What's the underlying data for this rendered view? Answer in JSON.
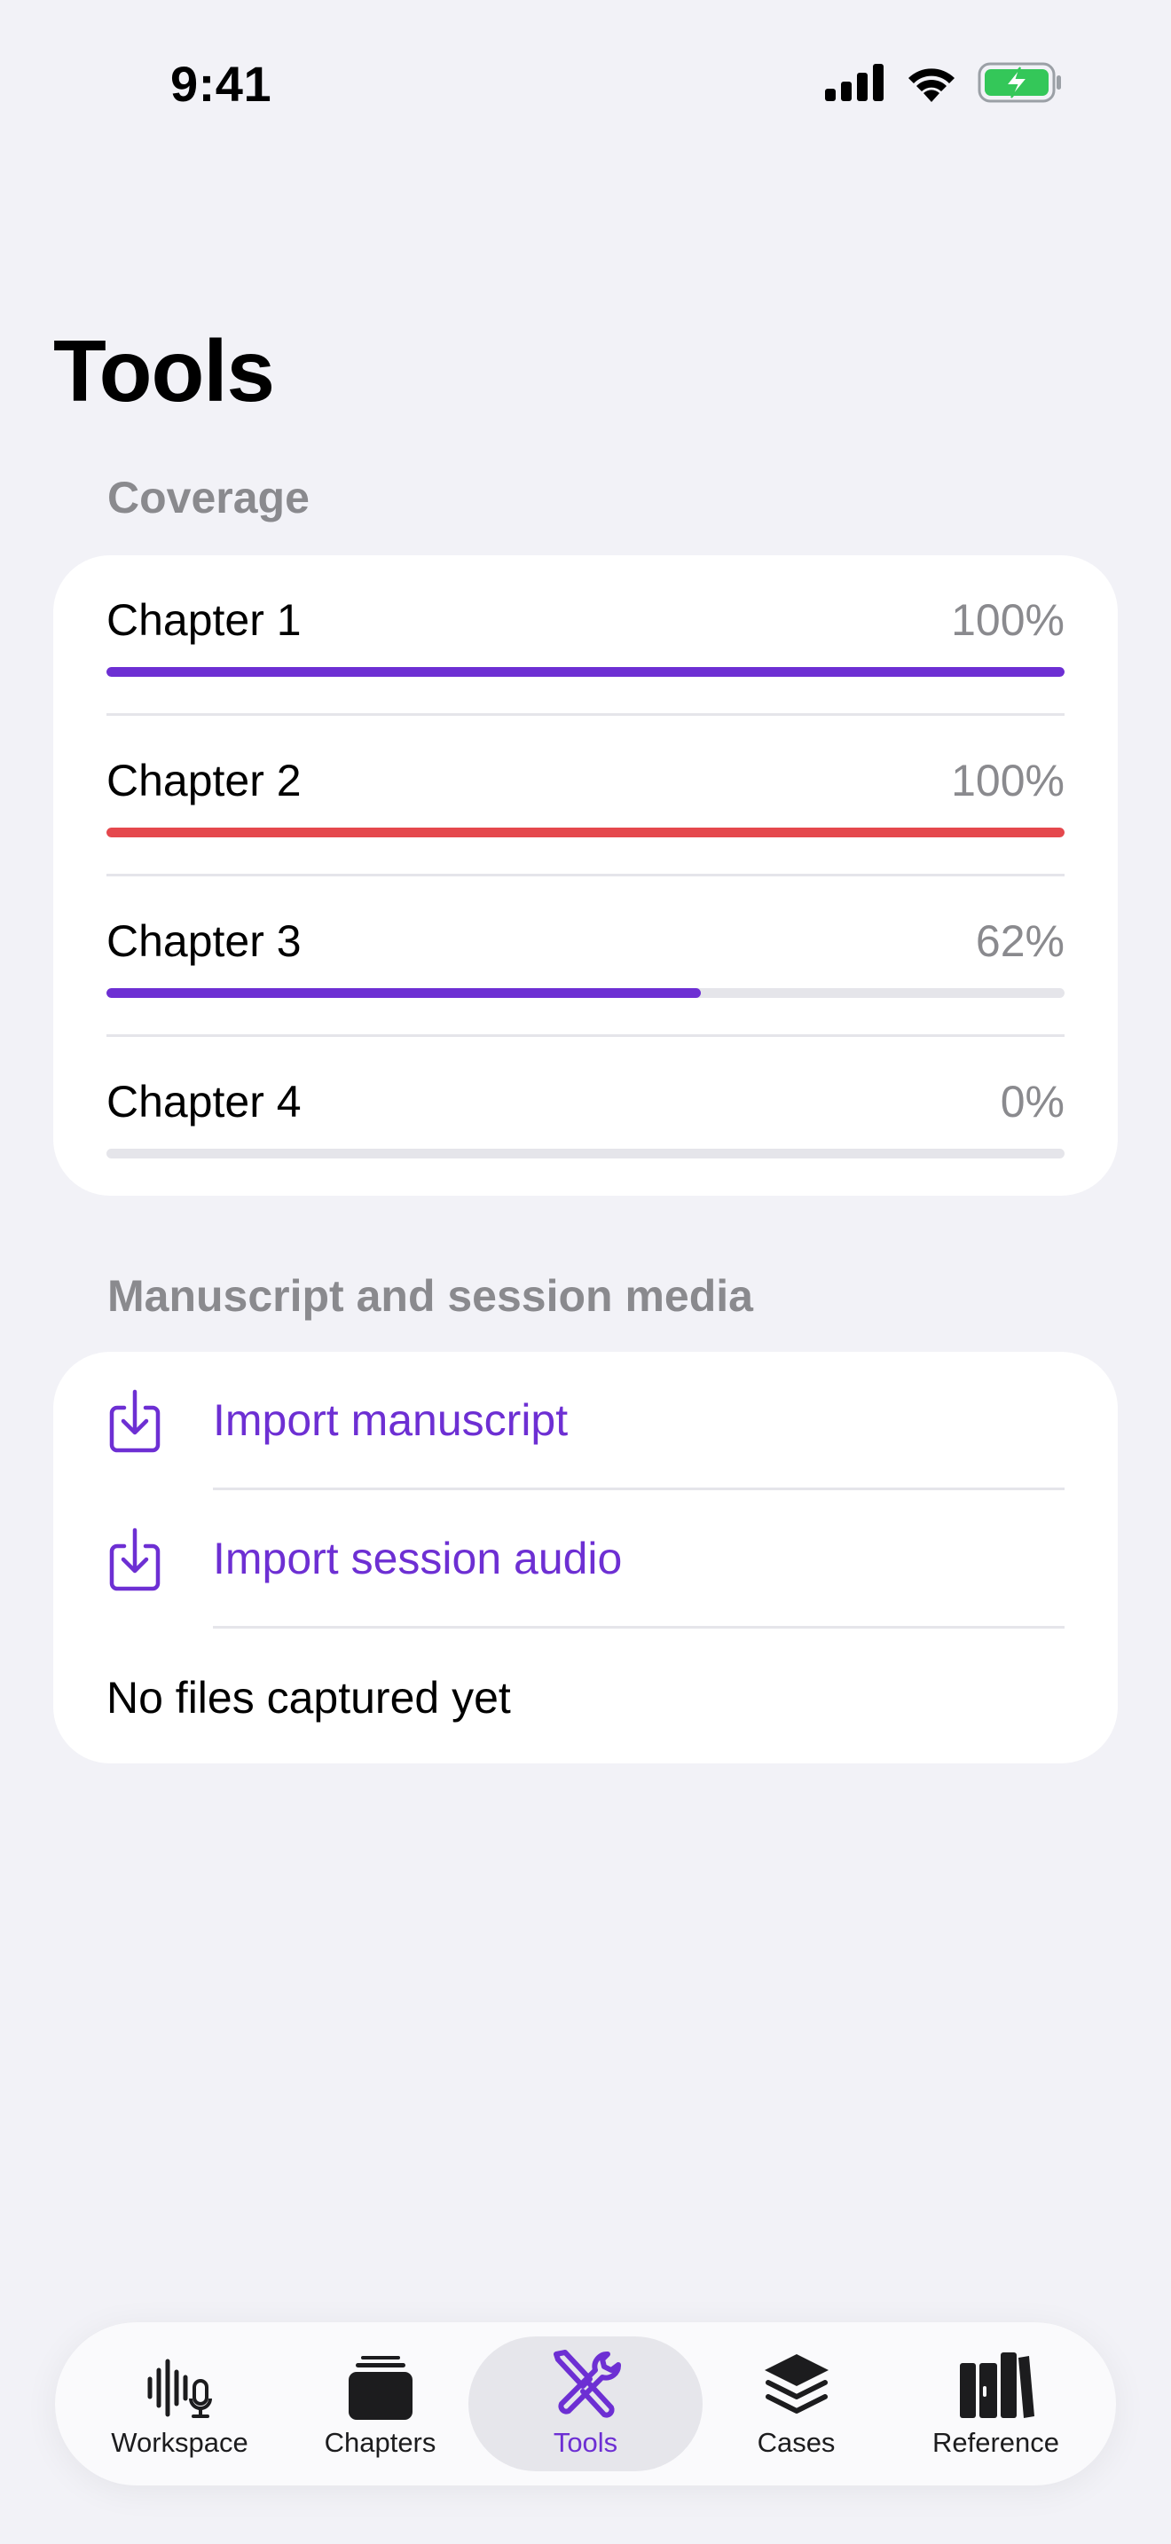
{
  "status_bar": {
    "time": "9:41"
  },
  "title": "Tools",
  "coverage": {
    "header": "Coverage",
    "items": [
      {
        "label": "Chapter 1",
        "percent_text": "100%",
        "progress": 1.0,
        "color": "#6D2FD3"
      },
      {
        "label": "Chapter 2",
        "percent_text": "100%",
        "progress": 1.0,
        "color": "#E5484D"
      },
      {
        "label": "Chapter 3",
        "percent_text": "62%",
        "progress": 0.62,
        "color": "#6D2FD3"
      },
      {
        "label": "Chapter 4",
        "percent_text": "0%",
        "progress": 0.0,
        "color": "#6D2FD3"
      }
    ]
  },
  "media": {
    "header": "Manuscript and session media",
    "actions": [
      {
        "label": "Import manuscript",
        "icon": "tray-download-icon"
      },
      {
        "label": "Import session audio",
        "icon": "tray-download-icon"
      }
    ],
    "status": "No files captured yet"
  },
  "tab_bar": {
    "tabs": [
      {
        "label": "Workspace",
        "icon": "waveform-mic-icon"
      },
      {
        "label": "Chapters",
        "icon": "stack-cards-icon"
      },
      {
        "label": "Tools",
        "icon": "wrench-screwdriver-icon",
        "active": true
      },
      {
        "label": "Cases",
        "icon": "layers-icon"
      },
      {
        "label": "Reference",
        "icon": "books-icon"
      }
    ]
  },
  "colors": {
    "accent": "#6D2FD3",
    "alert": "#E5484D",
    "background": "#F2F2F7"
  }
}
